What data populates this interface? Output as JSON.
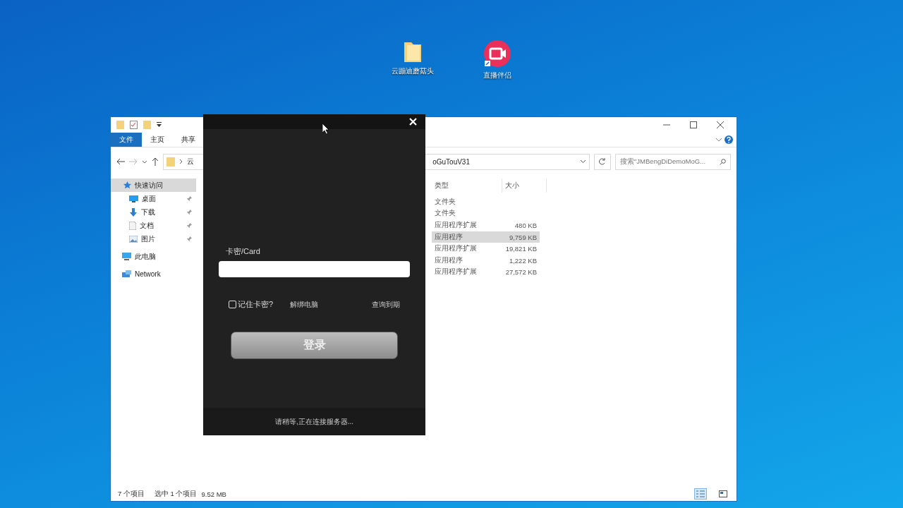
{
  "desktop_icons": [
    {
      "kind": "folder",
      "label": "云蹦迪蘑菇头"
    },
    {
      "kind": "app",
      "label": "直播伴侣"
    }
  ],
  "explorer": {
    "ribbon_tabs": [
      {
        "label": "文件",
        "selected": true
      },
      {
        "label": "主页",
        "selected": false
      },
      {
        "label": "共享",
        "selected": false
      }
    ],
    "address": {
      "start": "云",
      "end": "oGuTouV31"
    },
    "search": {
      "placeholder": "搜索\"JMBengDiDemoMoG..."
    },
    "sidebar": [
      {
        "kind": "star",
        "label": "快速访问",
        "selected": true,
        "children": [
          {
            "kind": "desktop",
            "label": "桌面",
            "pinned": true
          },
          {
            "kind": "download",
            "label": "下载",
            "pinned": true
          },
          {
            "kind": "document",
            "label": "文档",
            "pinned": true
          },
          {
            "kind": "picture",
            "label": "图片",
            "pinned": true
          }
        ]
      },
      {
        "kind": "computer",
        "label": "此电脑",
        "selected": false
      },
      {
        "kind": "network",
        "label": "Network",
        "selected": false
      }
    ],
    "columns": [
      "类型",
      "大小"
    ],
    "rows": [
      {
        "type": "文件夹",
        "size": "",
        "selected": false
      },
      {
        "type": "文件夹",
        "size": "",
        "selected": false
      },
      {
        "type": "应用程序扩展",
        "size": "480 KB",
        "selected": false
      },
      {
        "type": "应用程序",
        "size": "9,759 KB",
        "selected": true
      },
      {
        "type": "应用程序扩展",
        "size": "19,821 KB",
        "selected": false
      },
      {
        "type": "应用程序",
        "size": "1,222 KB",
        "selected": false
      },
      {
        "type": "应用程序扩展",
        "size": "27,572 KB",
        "selected": false
      }
    ],
    "status_bar": {
      "count": "7 个项目",
      "selection": "选中 1 个项目",
      "size": "9.52 MB"
    },
    "views": [
      {
        "kind": "details",
        "selected": true
      },
      {
        "kind": "tiles",
        "selected": false
      }
    ]
  },
  "login_dialog": {
    "card_label": "卡密/Card",
    "remember": {
      "label": "记住卡密?",
      "checked": false
    },
    "links": [
      "解绑电脑",
      "查询到期"
    ],
    "login_button": "登录",
    "status": "请稍等,正在连接服务器..."
  }
}
